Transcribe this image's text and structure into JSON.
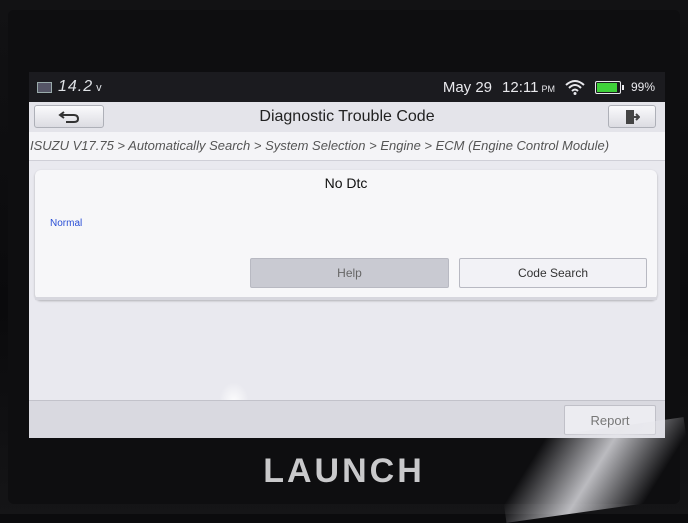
{
  "status_bar": {
    "voltage": "14.2",
    "voltage_unit": "v",
    "date": "May 29",
    "time": "12:11",
    "ampm": "PM",
    "battery_percent": "99%",
    "battery_level": 0.99,
    "icons": [
      "screen-icon",
      "wifi-icon",
      "battery-icon"
    ]
  },
  "header": {
    "title": "Diagnostic Trouble Code",
    "back_icon": "back-arrow-icon",
    "exit_icon": "exit-icon"
  },
  "breadcrumb": "ISUZU V17.75 > Automatically Search > System Selection > Engine > ECM (Engine Control Module)",
  "result": {
    "heading": "No Dtc",
    "status": "Normal",
    "status_color": "#2a4fd6"
  },
  "buttons": {
    "help": "Help",
    "code_search": "Code Search",
    "report": "Report"
  },
  "device": {
    "brand": "LAUNCH"
  }
}
